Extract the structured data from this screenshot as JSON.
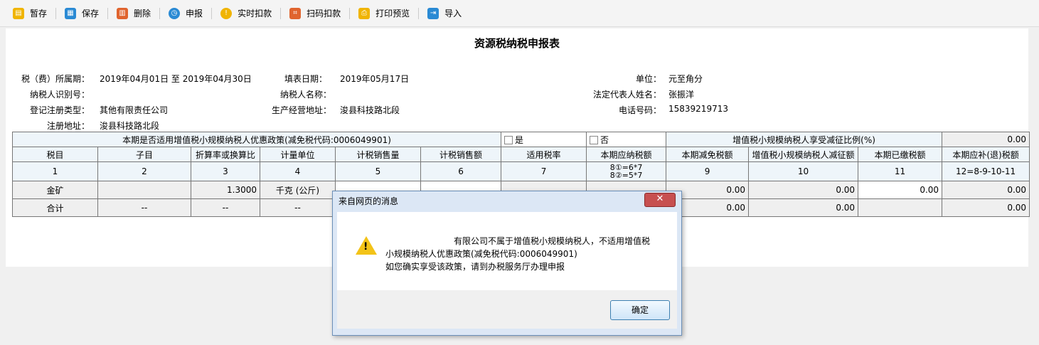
{
  "toolbar": [
    {
      "label": "暂存",
      "icon": "save-draft-icon",
      "color": "#f0b400"
    },
    {
      "label": "保存",
      "icon": "save-icon",
      "color": "#2a8ad4"
    },
    {
      "label": "删除",
      "icon": "delete-icon",
      "color": "#e0642e"
    },
    {
      "label": "申报",
      "icon": "declare-icon",
      "color": "#2a8ad4"
    },
    {
      "label": "实时扣款",
      "icon": "deduct-icon",
      "color": "#f0b400"
    },
    {
      "label": "扫码扣款",
      "icon": "scan-icon",
      "color": "#e0642e"
    },
    {
      "label": "打印预览",
      "icon": "print-icon",
      "color": "#f0b400"
    },
    {
      "label": "导入",
      "icon": "import-icon",
      "color": "#2a8ad4"
    }
  ],
  "form": {
    "title": "资源税纳税申报表",
    "period_label": "税（费）所属期：",
    "period_value": "2019年04月01日 至 2019年04月30日",
    "fill_date_label": "填表日期：",
    "fill_date_value": "2019年05月17日",
    "unit_label": "单位：",
    "unit_value": "元至角分",
    "taxpayer_id_label": "纳税人识别号：",
    "taxpayer_name_label": "纳税人名称：",
    "legal_rep_label": "法定代表人姓名：",
    "legal_rep_value": "张振洋",
    "reg_type_label": "登记注册类型：",
    "reg_type_value": "其他有限责任公司",
    "biz_addr_label": "生产经营地址：",
    "biz_addr_value": "浚县科技路北段",
    "phone_label": "电话号码：",
    "phone_value": "15839219713",
    "reg_addr_label": "注册地址：",
    "reg_addr_value": "浚县科技路北段"
  },
  "table": {
    "policy_question": "本期是否适用增值税小规模纳税人优惠政策(减免税代码:0006049901)",
    "yes": "是",
    "no": "否",
    "ratio_label": "增值税小规模纳税人享受减征比例(%)",
    "ratio_value": "0.00",
    "headers": [
      "税目",
      "子目",
      "折算率或换算比",
      "计量单位",
      "计税销售量",
      "计税销售额",
      "适用税率",
      "本期应纳税额",
      "本期减免税额",
      "增值税小规模纳税人减征额",
      "本期已缴税额",
      "本期应补(退)税额"
    ],
    "col_numbers": [
      "1",
      "2",
      "3",
      "4",
      "5",
      "6",
      "7",
      "8①=6*7\n8②=5*7",
      "9",
      "10",
      "11",
      "12=8-9-10-11"
    ],
    "row_item": {
      "name": "金矿",
      "sub": "",
      "rate": "1.3000",
      "unit": "千克 (公斤)",
      "v9": "0.00",
      "v10": "0.00",
      "v11": "0.00",
      "v12": "0.00"
    },
    "row_total": {
      "name": "合计",
      "c2": "--",
      "c3": "--",
      "c4": "--",
      "v9": "0.00",
      "v10": "0.00",
      "v12": "0.00"
    }
  },
  "dialog": {
    "title": "来自网页的消息",
    "close": "✕",
    "line1": "有限公司不属于增值税小规模纳税人，不适用增值税",
    "line2": "小规模纳税人优惠政策(减免税代码:0006049901)",
    "line3": "如您确实享受该政策，请到办税服务厅办理申报",
    "ok": "确定"
  }
}
